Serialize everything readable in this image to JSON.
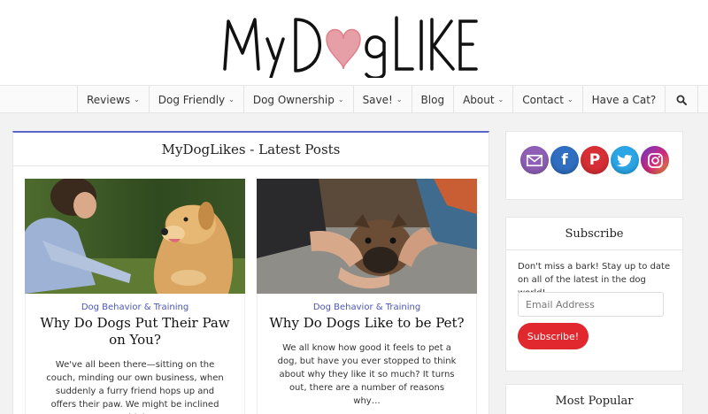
{
  "site": {
    "logo_text": "MyDogLikes"
  },
  "nav": {
    "items": [
      {
        "label": "Reviews",
        "has_dropdown": true
      },
      {
        "label": "Dog Friendly",
        "has_dropdown": true
      },
      {
        "label": "Dog Ownership",
        "has_dropdown": true
      },
      {
        "label": "Save!",
        "has_dropdown": true
      },
      {
        "label": "Blog",
        "has_dropdown": false
      },
      {
        "label": "About",
        "has_dropdown": true
      },
      {
        "label": "Contact",
        "has_dropdown": true
      },
      {
        "label": "Have a Cat?",
        "has_dropdown": false
      }
    ],
    "caret": "⌄",
    "search_icon": "search-icon"
  },
  "main": {
    "title": "MyDogLikes - Latest Posts",
    "posts": [
      {
        "category": "Dog Behavior & Training",
        "title": "Why Do Dogs Put Their Paw on You?",
        "excerpt": "We've all been there—sitting on the couch, minding our own business, when suddenly a furry friend hops up and offers their paw. We might be inclined to think…"
      },
      {
        "category": "Dog Behavior & Training",
        "title": "Why Do Dogs Like to be Pet?",
        "excerpt": "We all know how good it feels to pet a dog, but have you ever stopped to think about why they like it so much? It turns out, there are a number of reasons why…"
      }
    ]
  },
  "sidebar": {
    "social": [
      {
        "name": "mail-icon",
        "glyph": "✉",
        "color": "#8e5fb5"
      },
      {
        "name": "facebook-icon",
        "glyph": "f",
        "color": "#2f6ec0"
      },
      {
        "name": "pinterest-icon",
        "glyph": "P",
        "color": "#d62f35"
      },
      {
        "name": "twitter-icon",
        "glyph": "t",
        "color": "#2aa5e6"
      },
      {
        "name": "instagram-icon",
        "glyph": "◎",
        "color": "#d2297a"
      }
    ],
    "subscribe": {
      "title": "Subscribe",
      "text": "Don't miss a bark! Stay up to date on all of the latest in the dog world!",
      "email_placeholder": "Email Address",
      "button_label": "Subscribe!"
    },
    "popular": {
      "title": "Most Popular"
    }
  },
  "colors": {
    "accent": "#5b66c9",
    "link": "#4c56b9",
    "button": "#e0282e"
  }
}
